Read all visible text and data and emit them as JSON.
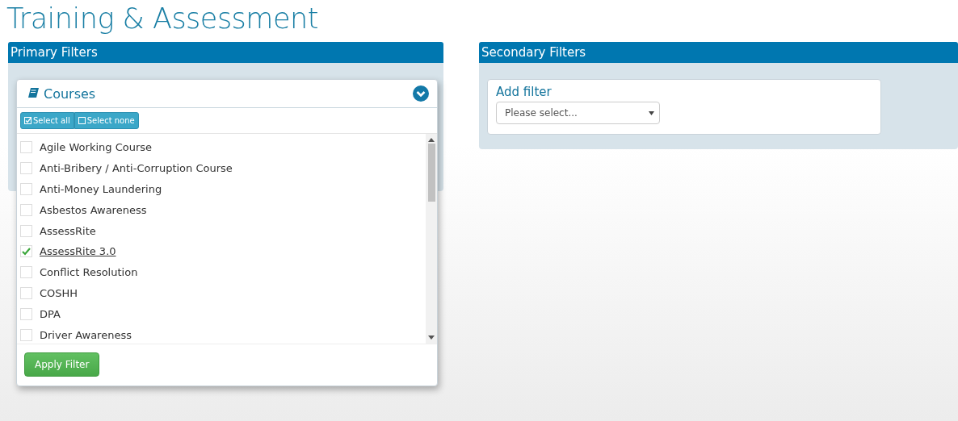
{
  "title": "Training & Assessment",
  "primary_filters": {
    "title": "Primary Filters",
    "filter": {
      "title": "Courses",
      "expanded": true,
      "buttons": [
        "Select all",
        "Select none"
      ],
      "items": [
        {
          "label": "Agile Working Course",
          "checked": false
        },
        {
          "label": "Anti-Bribery / Anti-Corruption Course",
          "checked": false
        },
        {
          "label": "Anti-Money Laundering",
          "checked": false
        },
        {
          "label": "Asbestos Awareness",
          "checked": false
        },
        {
          "label": "AssessRite",
          "checked": false
        },
        {
          "label": "AssessRite 3.0",
          "checked": true
        },
        {
          "label": "Conflict Resolution",
          "checked": false
        },
        {
          "label": "COSHH",
          "checked": false
        },
        {
          "label": "DPA",
          "checked": false
        },
        {
          "label": "Driver Awareness",
          "checked": false
        }
      ],
      "apply_button": "Apply Filter"
    }
  },
  "secondary_filters": {
    "title": "Secondary Filters",
    "add_filter": {
      "label": "Add filter",
      "placeholder": "Please select..."
    }
  }
}
